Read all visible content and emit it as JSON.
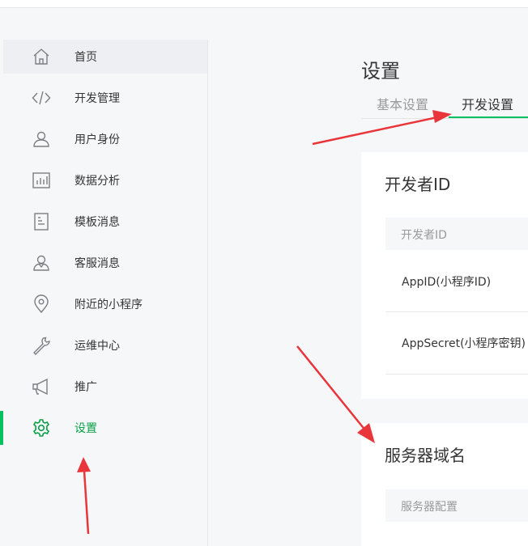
{
  "sidebar": {
    "items": [
      {
        "label": "首页",
        "icon": "home-icon"
      },
      {
        "label": "开发管理",
        "icon": "code-icon"
      },
      {
        "label": "用户身份",
        "icon": "user-icon"
      },
      {
        "label": "数据分析",
        "icon": "bar-chart-icon"
      },
      {
        "label": "模板消息",
        "icon": "document-icon"
      },
      {
        "label": "客服消息",
        "icon": "customer-service-icon"
      },
      {
        "label": "附近的小程序",
        "icon": "location-pin-icon"
      },
      {
        "label": "运维中心",
        "icon": "wrench-icon"
      },
      {
        "label": "推广",
        "icon": "megaphone-icon"
      },
      {
        "label": "设置",
        "icon": "gear-icon"
      }
    ],
    "active_item": "设置"
  },
  "main": {
    "title": "设置",
    "tabs": [
      {
        "label": "基本设置"
      },
      {
        "label": "开发设置"
      }
    ],
    "active_tab": "开发设置",
    "developer_card": {
      "title": "开发者ID",
      "table_header": "开发者ID",
      "rows": [
        "AppID(小程序ID)",
        "AppSecret(小程序密钥)"
      ]
    },
    "server_card": {
      "title": "服务器域名",
      "table_header": "服务器配置"
    }
  },
  "colors": {
    "accent": "#07c160",
    "annotation_arrow": "#e8363b",
    "background": "#f6f7f9"
  }
}
